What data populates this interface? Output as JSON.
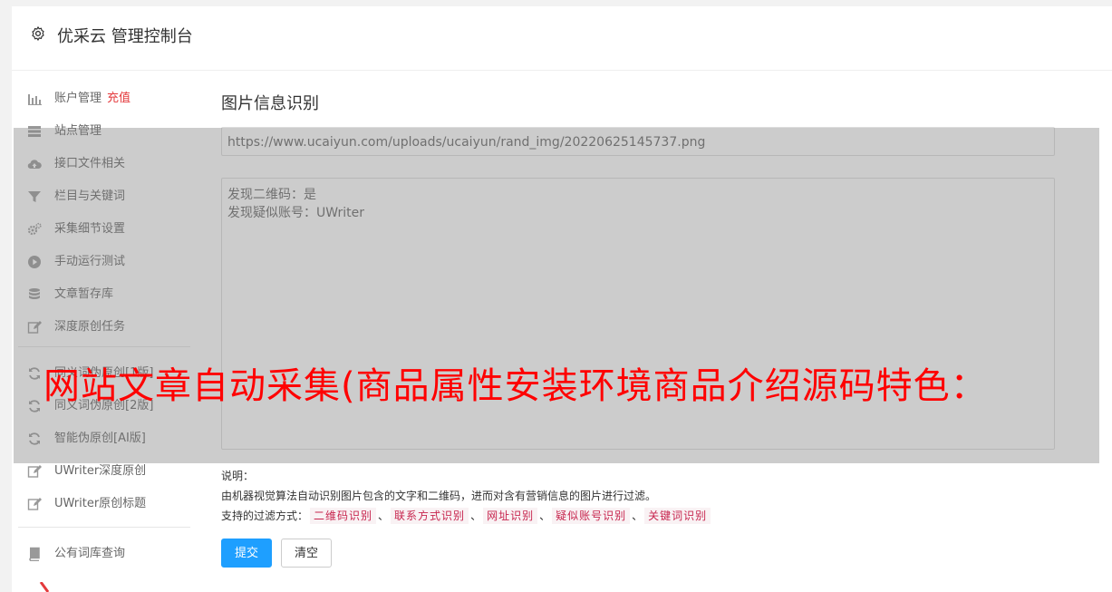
{
  "header": {
    "title": "优采云 管理控制台",
    "icon": "gear-icon"
  },
  "sidebar": {
    "items": [
      {
        "label": "账户管理",
        "badge": "充值",
        "icon": "bar-chart-icon"
      },
      {
        "label": "站点管理",
        "icon": "server-icon"
      },
      {
        "label": "接口文件相关",
        "icon": "cloud-upload-icon"
      },
      {
        "label": "栏目与关键词",
        "icon": "filter-icon"
      },
      {
        "label": "采集细节设置",
        "icon": "cogs-icon"
      },
      {
        "label": "手动运行测试",
        "icon": "play-circle-icon"
      },
      {
        "label": "文章暂存库",
        "icon": "database-icon"
      },
      {
        "label": "深度原创任务",
        "icon": "edit-icon"
      },
      {
        "label": "同义词伪原创[1版]",
        "icon": "refresh-icon"
      },
      {
        "label": "同义词伪原创[2版]",
        "icon": "refresh-icon"
      },
      {
        "label": "智能伪原创[AI版]",
        "icon": "refresh-icon"
      },
      {
        "label": "UWriter深度原创",
        "icon": "edit-icon"
      },
      {
        "label": "UWriter原创标题",
        "icon": "edit-icon"
      },
      {
        "label": "公有词库查询",
        "icon": "book-icon"
      }
    ]
  },
  "main": {
    "title": "图片信息识别",
    "url_value": "https://www.ucaiyun.com/uploads/ucaiyun/rand_img/20220625145737.png",
    "result_lines": [
      "发现二维码：是",
      "发现疑似账号：UWriter"
    ],
    "note_label": "说明：",
    "note_text": "由机器视觉算法自动识别图片包含的文字和二维码，进而对含有营销信息的图片进行过滤。",
    "filter_label": "支持的过滤方式：",
    "filters": [
      "二维码识别",
      "联系方式识别",
      "网址识别",
      "疑似账号识别",
      "关键词识别"
    ],
    "separator": "、",
    "submit_label": "提交",
    "clear_label": "清空"
  },
  "overlay": {
    "banner_text": "网站文章自动采集(商品属性安装环境商品介绍源码特色：",
    "banner_color": "#ff0000"
  },
  "colors": {
    "primary": "#1e9fff",
    "danger": "#e4393c",
    "tag_text": "#c7254e",
    "tag_bg": "#f9f2f4"
  }
}
